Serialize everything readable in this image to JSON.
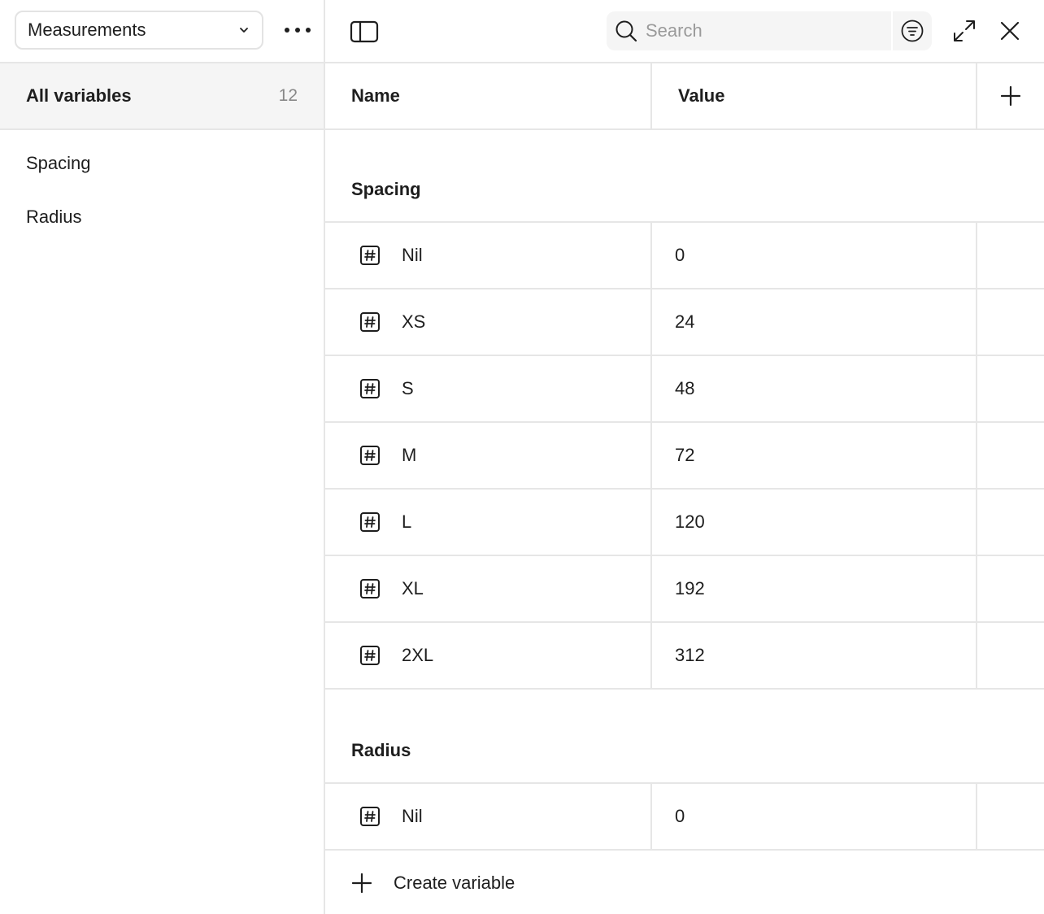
{
  "sidebar": {
    "collection": "Measurements",
    "all_variables": {
      "label": "All variables",
      "count": "12"
    },
    "groups": [
      "Spacing",
      "Radius"
    ]
  },
  "header": {
    "search_placeholder": "Search"
  },
  "table": {
    "columns": {
      "name": "Name",
      "value": "Value"
    },
    "groups": [
      {
        "title": "Spacing",
        "rows": [
          {
            "name": "Nil",
            "value": "0"
          },
          {
            "name": "XS",
            "value": "24"
          },
          {
            "name": "S",
            "value": "48"
          },
          {
            "name": "M",
            "value": "72"
          },
          {
            "name": "L",
            "value": "120"
          },
          {
            "name": "XL",
            "value": "192"
          },
          {
            "name": "2XL",
            "value": "312"
          }
        ]
      },
      {
        "title": "Radius",
        "rows": [
          {
            "name": "Nil",
            "value": "0"
          }
        ]
      }
    ],
    "create_label": "Create variable"
  },
  "icons": {
    "row": "number-variable-icon",
    "add": "plus-icon",
    "search": "search-icon",
    "filter": "filter-icon",
    "expand": "expand-icon",
    "close": "close-icon",
    "sidebar_toggle": "sidebar-toggle-icon",
    "more": "more-icon",
    "chevron": "chevron-down-icon"
  },
  "colors": {
    "border": "#e6e6e6",
    "selected_bg": "#f5f5f5",
    "text": "#1e1e1e",
    "muted": "#888888"
  }
}
